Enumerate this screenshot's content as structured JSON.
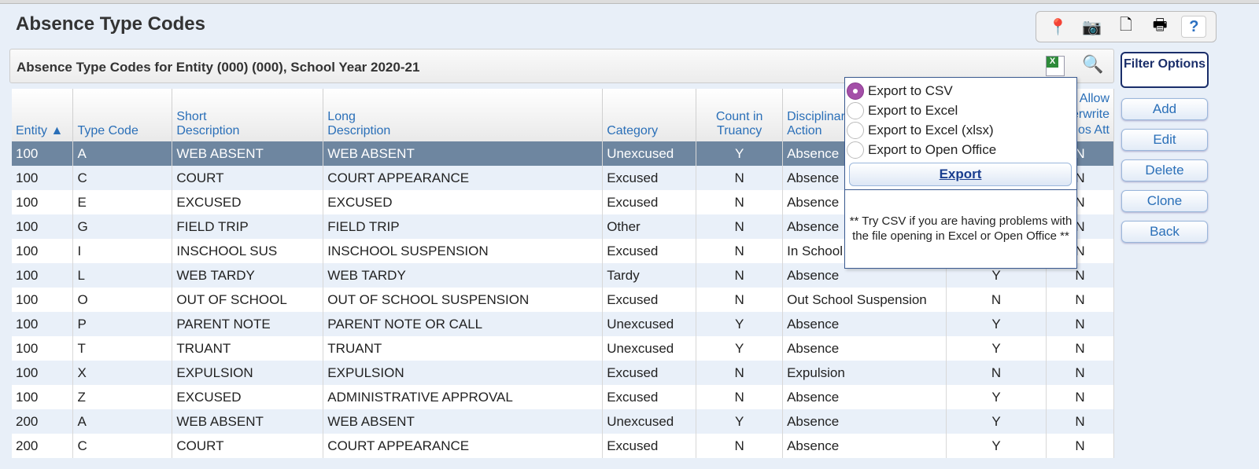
{
  "page": {
    "title": "Absence Type Codes"
  },
  "toolbar": {
    "icons": [
      "map-pin-icon",
      "camera-icon",
      "new-window-icon",
      "print-icon",
      "help-icon"
    ],
    "help_label": "?"
  },
  "panel": {
    "title": "Absence Type Codes for Entity (000) (000), School Year 2020-21"
  },
  "table": {
    "headers": [
      "Entity ▲",
      "Type Code",
      "Short\nDescription",
      "Long\nDescription",
      "Category",
      "Count in\nTruancy",
      "Disciplinary\nAction",
      "",
      "Allow\nOverwrite\nPos Att"
    ],
    "rows": [
      [
        "100",
        "A",
        "WEB ABSENT",
        "WEB ABSENT",
        "Unexcused",
        "Y",
        "Absence",
        "",
        "N"
      ],
      [
        "100",
        "C",
        "COURT",
        "COURT APPEARANCE",
        "Excused",
        "N",
        "Absence",
        "",
        "N"
      ],
      [
        "100",
        "E",
        "EXCUSED",
        "EXCUSED",
        "Excused",
        "N",
        "Absence",
        "",
        "N"
      ],
      [
        "100",
        "G",
        "FIELD TRIP",
        "FIELD TRIP",
        "Other",
        "N",
        "Absence",
        "",
        "N"
      ],
      [
        "100",
        "I",
        "INSCHOOL SUS",
        "INSCHOOL SUSPENSION",
        "Excused",
        "N",
        "In School",
        "",
        "N"
      ],
      [
        "100",
        "L",
        "WEB TARDY",
        "WEB TARDY",
        "Tardy",
        "N",
        "Absence",
        "Y",
        "N"
      ],
      [
        "100",
        "O",
        "OUT OF SCHOOL",
        "OUT OF SCHOOL SUSPENSION",
        "Excused",
        "N",
        "Out School Suspension",
        "N",
        "N"
      ],
      [
        "100",
        "P",
        "PARENT NOTE",
        "PARENT NOTE OR CALL",
        "Unexcused",
        "Y",
        "Absence",
        "Y",
        "N"
      ],
      [
        "100",
        "T",
        "TRUANT",
        "TRUANT",
        "Unexcused",
        "Y",
        "Absence",
        "Y",
        "N"
      ],
      [
        "100",
        "X",
        "EXPULSION",
        "EXPULSION",
        "Excused",
        "N",
        "Expulsion",
        "N",
        "N"
      ],
      [
        "100",
        "Z",
        "EXCUSED",
        "ADMINISTRATIVE APPROVAL",
        "Excused",
        "N",
        "Absence",
        "Y",
        "N"
      ],
      [
        "200",
        "A",
        "WEB ABSENT",
        "WEB ABSENT",
        "Unexcused",
        "Y",
        "Absence",
        "Y",
        "N"
      ],
      [
        "200",
        "C",
        "COURT",
        "COURT APPEARANCE",
        "Excused",
        "N",
        "Absence",
        "Y",
        "N"
      ]
    ]
  },
  "side": {
    "filter": "Filter Options",
    "add": "Add",
    "edit": "Edit",
    "delete": "Delete",
    "clone": "Clone",
    "back": "Back"
  },
  "export": {
    "options": [
      "Export to CSV",
      "Export to Excel",
      "Export to Excel (xlsx)",
      "Export to Open Office"
    ],
    "selected": 0,
    "button": "Export",
    "note": "** Try CSV if you are having problems with the file opening in Excel or Open Office **"
  },
  "colors": {
    "selected_row": "#6e86a0",
    "link": "#2a6fb8",
    "radio_selected": "#a44fa8"
  }
}
